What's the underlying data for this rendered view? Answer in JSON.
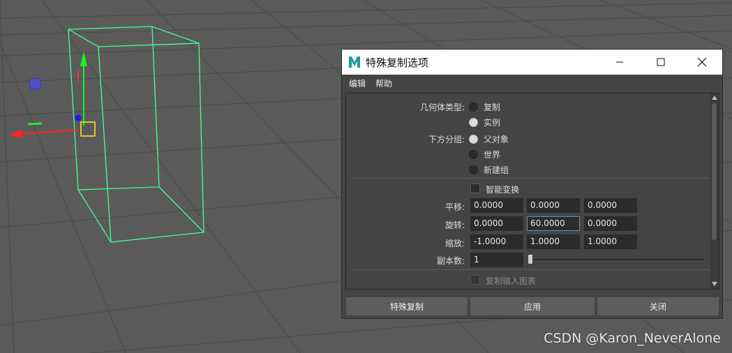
{
  "window": {
    "title": "特殊复制选项",
    "logo_icon": "maya-logo-icon"
  },
  "menu": {
    "items": [
      "编辑",
      "帮助"
    ]
  },
  "options": {
    "geometry_type": {
      "label": "几何体类型:",
      "choices": [
        "复制",
        "实例"
      ],
      "selected": "实例"
    },
    "group_under": {
      "label": "下方分组:",
      "choices": [
        "父对象",
        "世界",
        "新建组"
      ],
      "selected": "父对象"
    },
    "smart_transform": {
      "label": "智能变换",
      "checked": false
    },
    "translate": {
      "label": "平移:",
      "values": [
        "0.0000",
        "0.0000",
        "0.0000"
      ]
    },
    "rotate": {
      "label": "旋转:",
      "values": [
        "0.0000",
        "60.0000",
        "0.0000"
      ]
    },
    "scale": {
      "label": "缩放:",
      "values": [
        "-1.0000",
        "1.0000",
        "1.0000"
      ]
    },
    "copies": {
      "label": "副本数:",
      "value": "1"
    },
    "duplicate_input_graph": {
      "label": "复制输入图表",
      "checked": false
    }
  },
  "buttons": {
    "duplicate_special": "特殊复制",
    "apply": "应用",
    "close": "关闭"
  },
  "watermark": "CSDN @Karon_NeverAlone",
  "colors": {
    "viewport_bg": "#5a5a5a",
    "grid": "#4a4a4a",
    "wireframe": "#44ff99",
    "dialog_bg": "#444444"
  }
}
